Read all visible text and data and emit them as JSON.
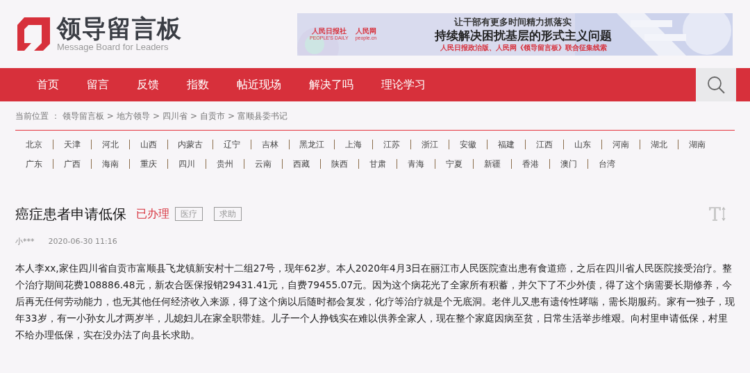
{
  "logo": {
    "title": "领导留言板",
    "subtitle": "Message Board for Leaders"
  },
  "banner": {
    "brand_1": "人民日报社",
    "brand_1_en": "PEOPLE'S DAILY",
    "brand_2": "人民网",
    "brand_2_en": "people.cn",
    "line_1": "让干部有更多时间精力抓落实",
    "line_2": "持续解决困扰基层的形式主义问题",
    "line_3": "人民日报政治版、人民网《领导留言板》联合征集线索"
  },
  "nav": {
    "items": [
      "首页",
      "留言",
      "反馈",
      "指数",
      "帖近现场",
      "解决了吗",
      "理论学习"
    ]
  },
  "breadcrumb": {
    "label": "当前位置 ：",
    "items": [
      "领导留言板",
      "地方领导",
      "四川省",
      "自贡市",
      "富顺县委书记"
    ],
    "separator": ">"
  },
  "provinces": [
    "北京",
    "天津",
    "河北",
    "山西",
    "内蒙古",
    "辽宁",
    "吉林",
    "黑龙江",
    "上海",
    "江苏",
    "浙江",
    "安徽",
    "福建",
    "江西",
    "山东",
    "河南",
    "湖北",
    "湖南",
    "广东",
    "广西",
    "海南",
    "重庆",
    "四川",
    "贵州",
    "云南",
    "西藏",
    "陕西",
    "甘肃",
    "青海",
    "宁夏",
    "新疆",
    "香港",
    "澳门",
    "台湾"
  ],
  "post": {
    "title": "癌症患者申请低保",
    "status": "已办理",
    "tags": [
      "医疗",
      "求助"
    ],
    "author": "小***",
    "time": "2020-06-30 11:16",
    "body": "本人李xx,家住四川省自贡市富顺县飞龙镇新安村十二组27号，现年62岁。本人2020年4月3日在丽江市人民医院查出患有食道癌，之后在四川省人民医院接受治疗。整个治疗期间花费108886.48元，新农合医保报销29431.41元，自费79455.07元。因为这个病花光了全家所有积蓄，并欠下了不少外债，得了这个病需要长期修养，今后再无任何劳动能力，也无其他任何经济收入来源，得了这个病以后随时都会复发，化疗等治疗就是个无底洞。老伴儿又患有遗传性哮喘，需长期服药。家有一独子，现年33岁，有一小孙女儿才两岁半，儿媳妇儿在家全职带娃。儿子一个人挣钱实在难以供养全家人，现在整个家庭因病至贫，日常生活举步维艰。向村里申请低保，村里不给办理低保，实在没办法了向县长求助。"
  }
}
